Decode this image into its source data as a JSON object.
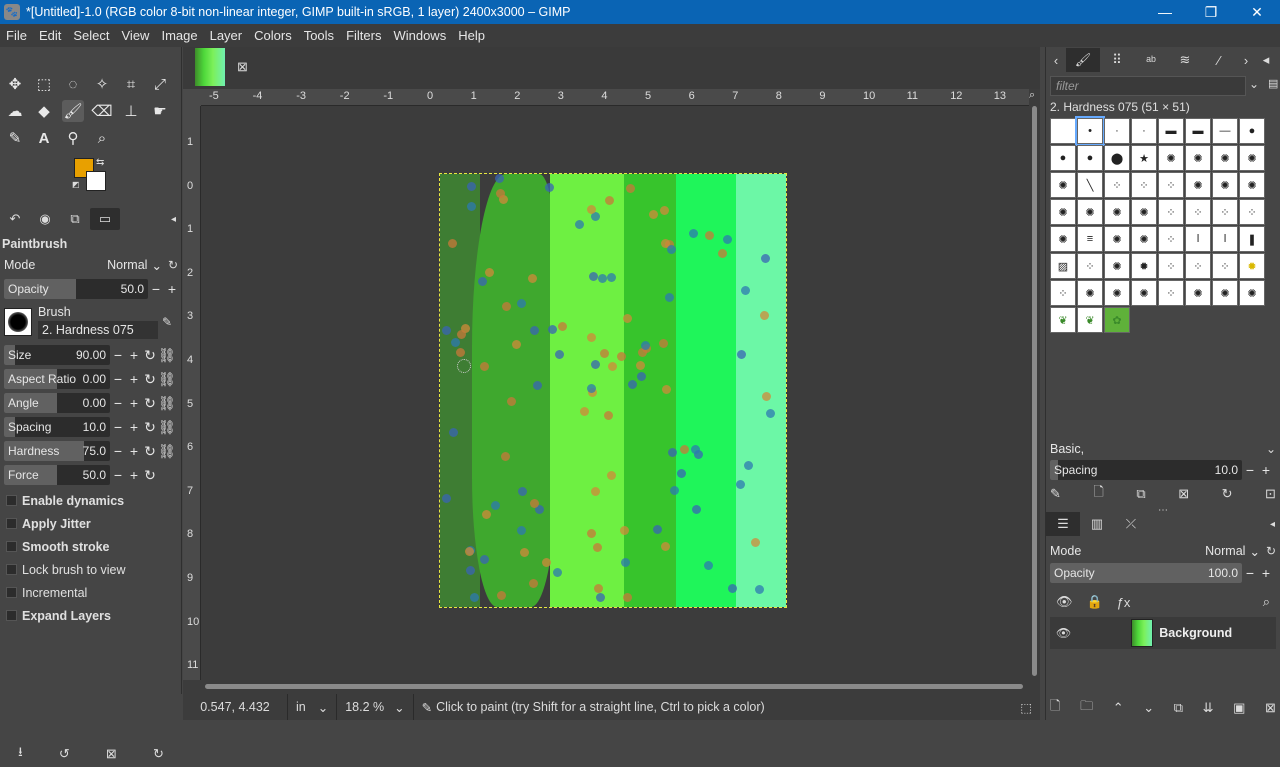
{
  "window": {
    "title": "*[Untitled]-1.0 (RGB color 8-bit non-linear integer, GIMP built-in sRGB, 1 layer) 2400x3000 – GIMP",
    "minimize": "—",
    "restore": "❐",
    "close": "✕"
  },
  "menu": [
    "File",
    "Edit",
    "Select",
    "View",
    "Image",
    "Layer",
    "Colors",
    "Tools",
    "Filters",
    "Windows",
    "Help"
  ],
  "colors": {
    "foreground": "#e8a000",
    "background": "#ffffff"
  },
  "tool_options": {
    "title": "Paintbrush",
    "mode_label": "Mode",
    "mode_value": "Normal",
    "opacity_label": "Opacity",
    "opacity_value": "50.0",
    "brush_label": "Brush",
    "brush_value": "2. Hardness 075",
    "sliders": [
      {
        "label": "Size",
        "value": "90.00",
        "fill": 0.1
      },
      {
        "label": "Aspect Ratio",
        "value": "0.00",
        "fill": 0.5
      },
      {
        "label": "Angle",
        "value": "0.00",
        "fill": 0.5
      },
      {
        "label": "Spacing",
        "value": "10.0",
        "fill": 0.1
      },
      {
        "label": "Hardness",
        "value": "75.0",
        "fill": 0.75
      },
      {
        "label": "Force",
        "value": "50.0",
        "fill": 0.5
      }
    ],
    "checks": [
      {
        "label": "Enable dynamics",
        "bold": true
      },
      {
        "label": "Apply Jitter",
        "bold": true
      },
      {
        "label": "Smooth stroke",
        "bold": true
      },
      {
        "label": "Lock brush to view",
        "bold": false
      },
      {
        "label": "Incremental",
        "bold": false
      },
      {
        "label": "Expand Layers",
        "bold": true
      }
    ]
  },
  "rulers": {
    "h": [
      "-5",
      "-4",
      "-3",
      "-2",
      "-1",
      "0",
      "1",
      "2",
      "3",
      "4",
      "5",
      "6",
      "7",
      "8",
      "9",
      "10",
      "11",
      "12",
      "13"
    ],
    "v": [
      "1",
      "0",
      "1",
      "2",
      "3",
      "4",
      "5",
      "6",
      "7",
      "8",
      "9",
      "10",
      "11"
    ]
  },
  "status": {
    "coords": "0.547, 4.432",
    "unit": "in",
    "zoom": "18.2 %",
    "message": "Click to paint (try Shift for a straight line, Ctrl to pick a color)"
  },
  "brushes": {
    "filter_placeholder": "filter",
    "selected_name": "2. Hardness 075 (51 × 51)",
    "preset": "Basic,",
    "spacing_label": "Spacing",
    "spacing_value": "10.0"
  },
  "layers": {
    "mode_label": "Mode",
    "mode_value": "Normal",
    "opacity_label": "Opacity",
    "opacity_value": "100.0",
    "layer_name": "Background"
  }
}
